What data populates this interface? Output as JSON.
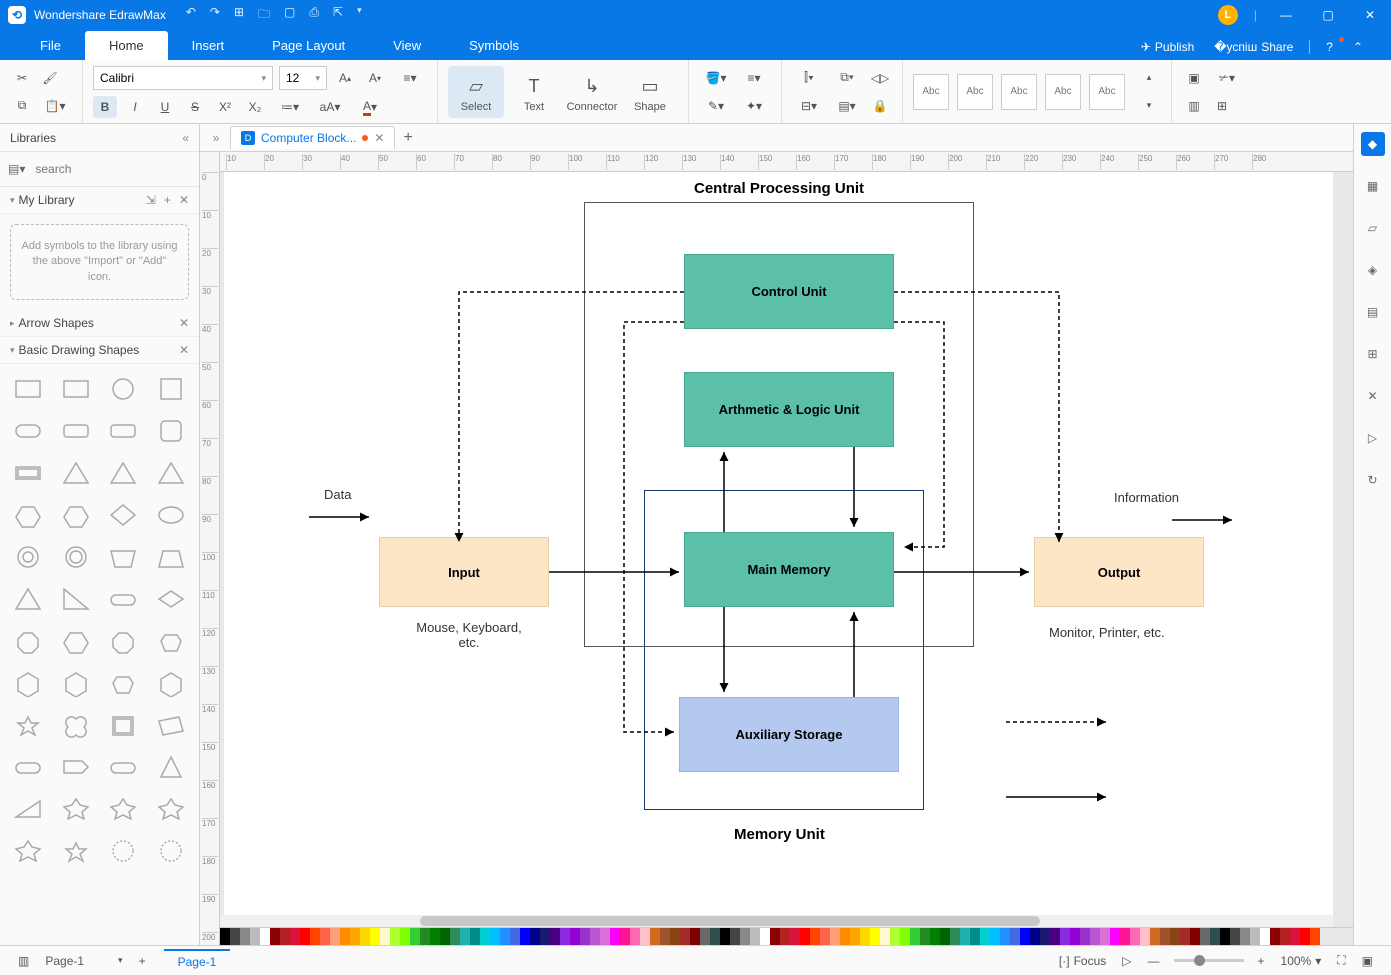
{
  "app": {
    "title": "Wondershare EdrawMax"
  },
  "menu": {
    "tabs": [
      "File",
      "Home",
      "Insert",
      "Page Layout",
      "View",
      "Symbols"
    ],
    "active": 1,
    "publish": "Publish",
    "share": "Share"
  },
  "ribbon": {
    "font": "Calibri",
    "size": "12",
    "tools": {
      "select": "Select",
      "text": "Text",
      "connector": "Connector",
      "shape": "Shape"
    },
    "themes": [
      "Abc",
      "Abc",
      "Abc",
      "Abc",
      "Abc"
    ]
  },
  "library": {
    "title": "Libraries",
    "search_ph": "search",
    "mylib": "My Library",
    "mylib_empty": "Add symbols to the library using the above \"Import\" or \"Add\" icon.",
    "cats": [
      "Arrow Shapes",
      "Basic Drawing Shapes"
    ]
  },
  "doc": {
    "tab_name": "Computer Block..."
  },
  "diagram": {
    "title_top": "Central Processing Unit",
    "title_bottom": "Memory Unit",
    "control": "Control Unit",
    "alu": "Arthmetic & Logic Unit",
    "mem": "Main Memory",
    "aux": "Auxiliary Storage",
    "input": "Input",
    "output": "Output",
    "input_sub": "Mouse, Keyboard, etc.",
    "output_sub": "Monitor, Printer, etc.",
    "data": "Data",
    "info": "Information"
  },
  "status": {
    "page": "Page-1",
    "pagetab": "Page-1",
    "focus": "Focus",
    "zoom": "100%"
  },
  "ruler_h": [
    10,
    20,
    30,
    40,
    50,
    60,
    70,
    80,
    90,
    100,
    110,
    120,
    130,
    140,
    150,
    160,
    170,
    180,
    190,
    200,
    210,
    220,
    230,
    240,
    250,
    260,
    270,
    280
  ],
  "ruler_v": [
    0,
    10,
    20,
    30,
    40,
    50,
    60,
    70,
    80,
    90,
    100,
    110,
    120,
    130,
    140,
    150,
    160,
    170,
    180,
    190,
    200
  ]
}
